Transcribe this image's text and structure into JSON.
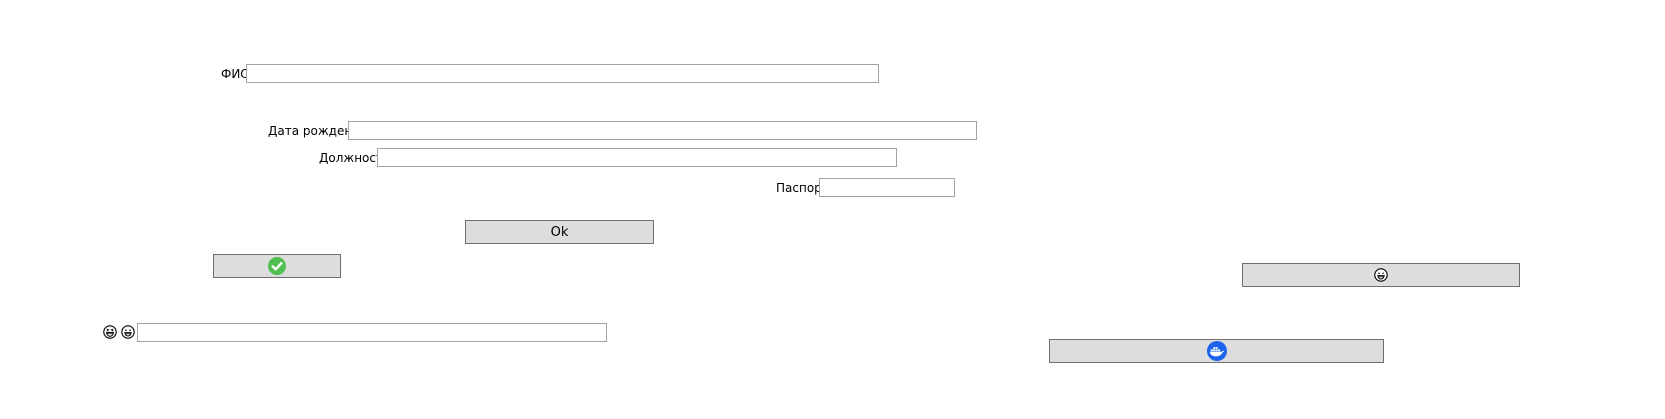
{
  "form": {
    "fio_label": "ФИО",
    "fio_value": "",
    "birth_label": "Дата рождения",
    "birth_value": "",
    "position_label": "Должность",
    "position_value": "",
    "passport_label": "Паспорт",
    "passport_value": ""
  },
  "buttons": {
    "ok_label": "Ok",
    "confirm_icon": "check-circle-icon",
    "emoji_icon": "grinning-face-icon",
    "docker_icon": "docker-whale-icon"
  },
  "emoji_row": {
    "icons": [
      "laughing-face-icon",
      "grinning-face-icon"
    ],
    "value": ""
  },
  "colors": {
    "button_bg": "#dddddd",
    "check_green": "#4fbf4f",
    "docker_blue": "#1d63ed"
  }
}
